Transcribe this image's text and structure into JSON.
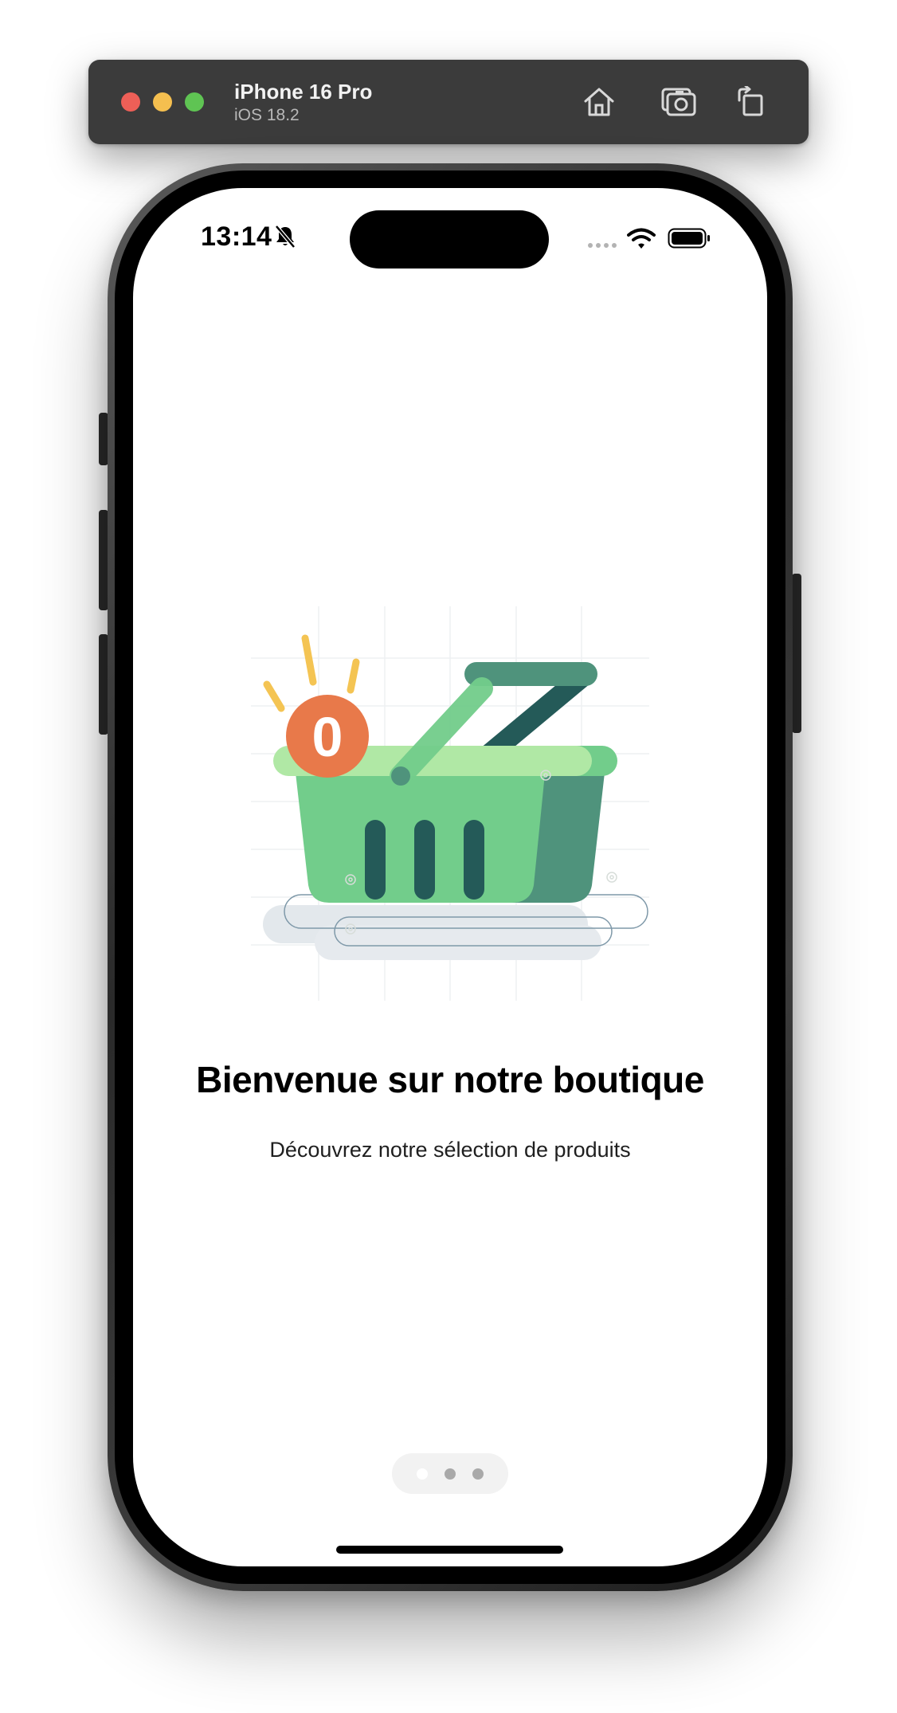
{
  "toolbar": {
    "device_name": "iPhone 16 Pro",
    "os_version": "iOS 18.2",
    "buttons": {
      "home": "home-icon",
      "screenshot": "camera-icon",
      "rotate": "rotate-icon"
    }
  },
  "status_bar": {
    "time": "13:14",
    "silent_mode": "bell-slash-icon",
    "wifi": "wifi-icon",
    "battery": "battery-icon"
  },
  "illustration": {
    "badge_count": "0",
    "colors": {
      "basket_light": "#72cd8b",
      "basket_dark": "#4f937c",
      "rim_light": "#b0e8a5",
      "handle_dark": "#245a58",
      "badge": "#e8794a",
      "sparkle": "#f4c453"
    }
  },
  "content": {
    "title": "Bienvenue sur notre boutique",
    "subtitle": "Découvrez notre sélection de produits"
  },
  "page_control": {
    "pages": 3,
    "current_page": 1
  }
}
